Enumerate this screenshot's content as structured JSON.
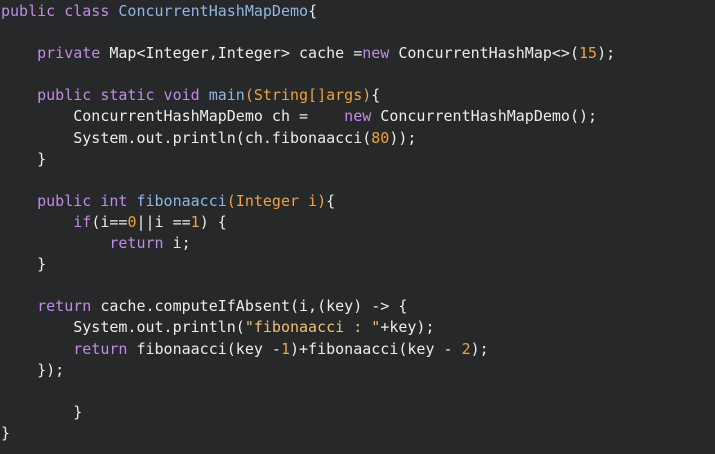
{
  "editor": {
    "theme_colors": {
      "background": "#262829",
      "keyword": "#c28be8",
      "type": "#8fb7e6",
      "parameter": "#f0a23c",
      "number": "#f0a23c",
      "string": "#f2c06b",
      "plain": "#ececec"
    },
    "lines": [
      [
        {
          "c": "kw",
          "t": "public class "
        },
        {
          "c": "typ",
          "t": "ConcurrentHashMapDemo"
        },
        {
          "c": "pl",
          "t": "{"
        }
      ],
      [],
      [
        {
          "c": "kw",
          "t": "    private "
        },
        {
          "c": "pl",
          "t": "Map<Integer,Integer> cache ="
        },
        {
          "c": "kw",
          "t": "new "
        },
        {
          "c": "pl",
          "t": "ConcurrentHashMap<>("
        },
        {
          "c": "num",
          "t": "15"
        },
        {
          "c": "pl",
          "t": ");"
        }
      ],
      [],
      [
        {
          "c": "kw",
          "t": "    public static void "
        },
        {
          "c": "fn",
          "t": "main"
        },
        {
          "c": "par",
          "t": "(String[]args)"
        },
        {
          "c": "pl",
          "t": "{"
        }
      ],
      [
        {
          "c": "pl",
          "t": "        ConcurrentHashMapDemo ch =    "
        },
        {
          "c": "kw",
          "t": "new "
        },
        {
          "c": "pl",
          "t": "ConcurrentHashMapDemo();"
        }
      ],
      [
        {
          "c": "pl",
          "t": "        System.out.println(ch.fibonaacci("
        },
        {
          "c": "num",
          "t": "80"
        },
        {
          "c": "pl",
          "t": "));"
        }
      ],
      [
        {
          "c": "pl",
          "t": "    }"
        }
      ],
      [],
      [
        {
          "c": "kw",
          "t": "    public int "
        },
        {
          "c": "fn",
          "t": "fibonaacci"
        },
        {
          "c": "par",
          "t": "(Integer i)"
        },
        {
          "c": "pl",
          "t": "{"
        }
      ],
      [
        {
          "c": "kw",
          "t": "        if"
        },
        {
          "c": "pl",
          "t": "(i=="
        },
        {
          "c": "num",
          "t": "0"
        },
        {
          "c": "pl",
          "t": "||i =="
        },
        {
          "c": "num",
          "t": "1"
        },
        {
          "c": "pl",
          "t": ") {"
        }
      ],
      [
        {
          "c": "kw",
          "t": "            return "
        },
        {
          "c": "pl",
          "t": "i;"
        }
      ],
      [
        {
          "c": "pl",
          "t": "    }"
        }
      ],
      [],
      [
        {
          "c": "kw",
          "t": "    return "
        },
        {
          "c": "pl",
          "t": "cache.computeIfAbsent(i,(key) -> {"
        }
      ],
      [
        {
          "c": "pl",
          "t": "        System.out.println("
        },
        {
          "c": "str",
          "t": "\"fibonaacci : \""
        },
        {
          "c": "pl",
          "t": "+key);"
        }
      ],
      [
        {
          "c": "kw",
          "t": "        return "
        },
        {
          "c": "pl",
          "t": "fibonaacci(key -"
        },
        {
          "c": "num",
          "t": "1"
        },
        {
          "c": "pl",
          "t": ")+fibonaacci(key - "
        },
        {
          "c": "num",
          "t": "2"
        },
        {
          "c": "pl",
          "t": ");"
        }
      ],
      [
        {
          "c": "pl",
          "t": "    });"
        }
      ],
      [],
      [
        {
          "c": "pl",
          "t": "        }"
        }
      ],
      [
        {
          "c": "pl",
          "t": "}"
        }
      ]
    ]
  }
}
